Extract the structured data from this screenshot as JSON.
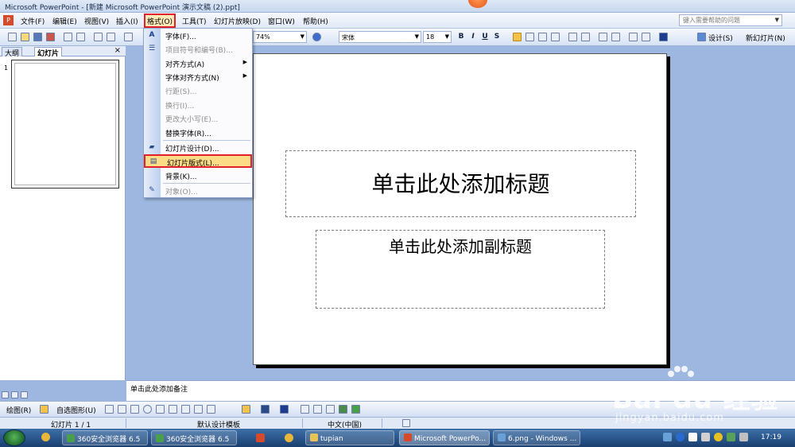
{
  "window": {
    "title": "Microsoft PowerPoint - [新建 Microsoft PowerPoint 演示文稿 (2).ppt]"
  },
  "menubar": {
    "items": [
      "文件(F)",
      "编辑(E)",
      "视图(V)",
      "插入(I)",
      "格式(O)",
      "工具(T)",
      "幻灯片放映(D)",
      "窗口(W)",
      "帮助(H)"
    ],
    "help_placeholder": "键入需要帮助的问题"
  },
  "toolbar": {
    "zoom": "74%",
    "font_name": "宋体",
    "font_size": "18",
    "bold": "B",
    "italic": "I",
    "underline": "U",
    "shadow": "S",
    "design_label": "设计(S)",
    "new_slide_label": "新幻灯片(N)"
  },
  "format_menu": {
    "items": [
      {
        "label": "字体(F)...",
        "icon": "A",
        "disabled": false,
        "submenu": false
      },
      {
        "label": "项目符号和编号(B)...",
        "icon": "list-icon",
        "disabled": true,
        "submenu": false
      },
      {
        "label": "对齐方式(A)",
        "disabled": false,
        "submenu": true
      },
      {
        "label": "字体对齐方式(N)",
        "disabled": false,
        "submenu": true
      },
      {
        "label": "行距(S)...",
        "disabled": true,
        "submenu": false
      },
      {
        "label": "换行(I)...",
        "disabled": true,
        "submenu": false
      },
      {
        "label": "更改大小写(E)...",
        "disabled": true,
        "submenu": false
      },
      {
        "label": "替换字体(R)...",
        "disabled": false,
        "submenu": false
      },
      {
        "label": "幻灯片设计(D)...",
        "icon": "design-icon",
        "disabled": false,
        "submenu": false
      },
      {
        "label": "幻灯片版式(L)...",
        "icon": "layout-icon",
        "disabled": false,
        "submenu": false,
        "highlighted": true
      },
      {
        "label": "背景(K)...",
        "disabled": false,
        "submenu": false
      },
      {
        "label": "对象(O)...",
        "icon": "object-icon",
        "disabled": true,
        "submenu": false
      }
    ]
  },
  "left_pane": {
    "tab_outline": "大纲",
    "tab_slides": "幻灯片",
    "close": "×",
    "slide_number": "1"
  },
  "slide": {
    "title_placeholder": "单击此处添加标题",
    "subtitle_placeholder": "单击此处添加副标题"
  },
  "notes": {
    "placeholder": "单击此处添加备注"
  },
  "drawbar": {
    "draw_label": "绘图(R)",
    "autoshapes_label": "自选图形(U)"
  },
  "statusbar": {
    "slide_info": "幻灯片 1 / 1",
    "template": "默认设计模板",
    "language": "中文(中国)"
  },
  "taskbar": {
    "items": [
      "360安全浏览器 6.5",
      "360安全浏览器 6.5",
      "tupian",
      "Microsoft PowerPo...",
      "6.png - Windows ..."
    ],
    "clock": "17:19"
  },
  "watermark": {
    "brand": "Bai du 经验",
    "url": "jingyan.baidu.com"
  },
  "colors": {
    "highlight_border": "#e0202a",
    "menu_highlight": "#fcdb86",
    "taskbar": "#1a3f70"
  }
}
